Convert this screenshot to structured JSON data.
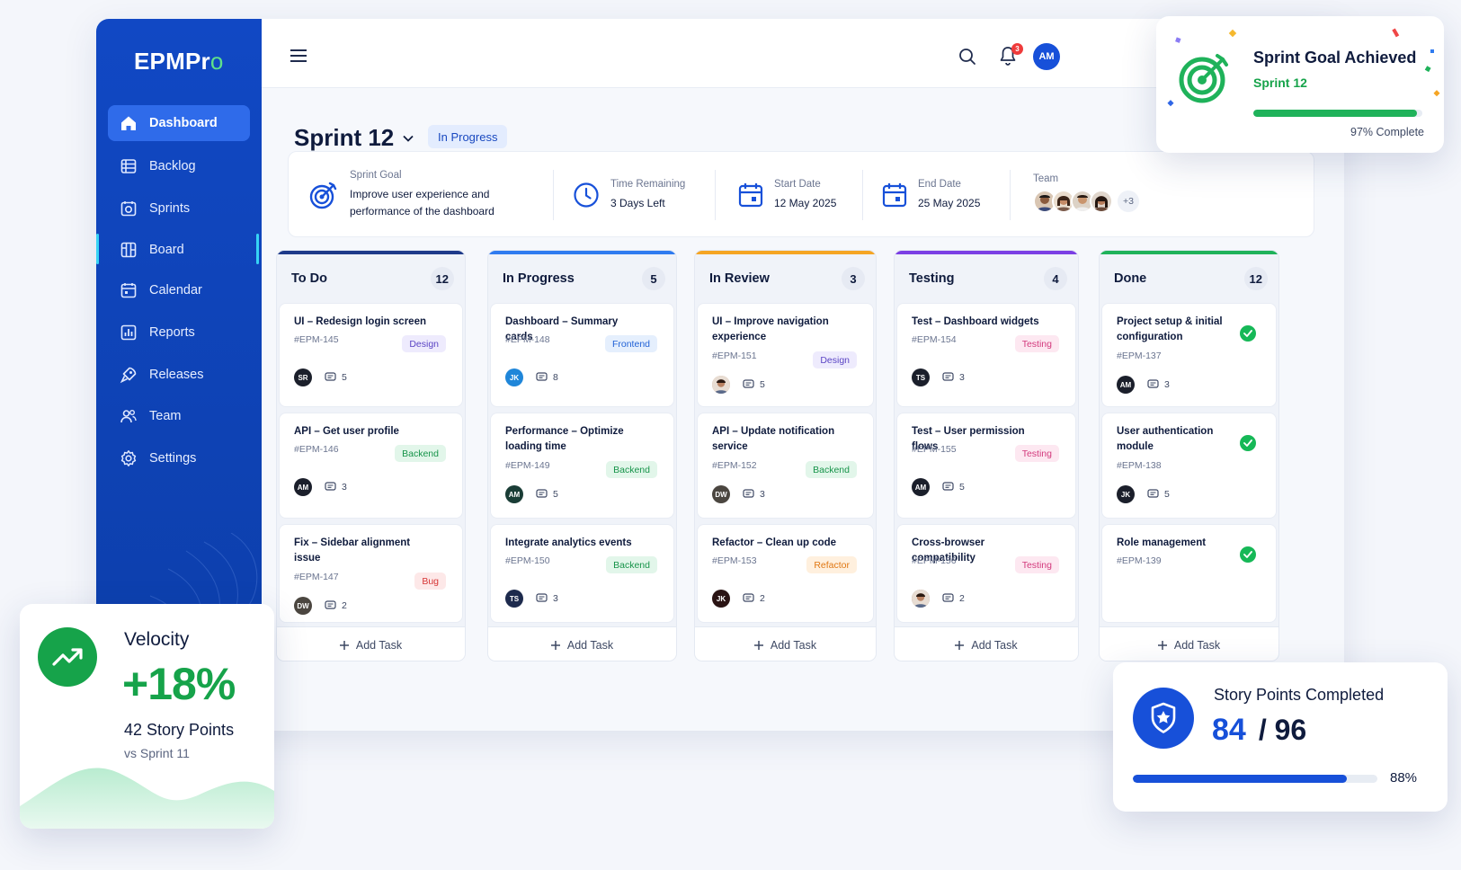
{
  "app": {
    "logo_main": "EPMPr",
    "logo_accent": "o"
  },
  "sidebar": {
    "items": [
      {
        "label": "Dashboard",
        "icon": "home-icon",
        "active": true
      },
      {
        "label": "Backlog",
        "icon": "list-icon"
      },
      {
        "label": "Sprints",
        "icon": "sprint-icon"
      },
      {
        "label": "Board",
        "icon": "board-icon",
        "marked": true
      },
      {
        "label": "Calendar",
        "icon": "calendar-icon"
      },
      {
        "label": "Reports",
        "icon": "reports-icon"
      },
      {
        "label": "Releases",
        "icon": "releases-icon"
      },
      {
        "label": "Team",
        "icon": "team-icon"
      },
      {
        "label": "Settings",
        "icon": "settings-icon"
      }
    ]
  },
  "topbar": {
    "notification_count": "3",
    "user_initials": "AM"
  },
  "sprint": {
    "title": "Sprint 12",
    "status": "In Progress"
  },
  "info": {
    "goal_label": "Sprint Goal",
    "goal_line1": "Improve user experience and",
    "goal_line2": "performance of the dashboard",
    "time_label": "Time Remaining",
    "time_value": "3 Days Left",
    "start_label": "Start Date",
    "start_value": "12 May 2025",
    "end_label": "End Date",
    "end_value": "25 May 2025",
    "team_label": "Team",
    "team_more": "+3"
  },
  "board": {
    "add_task_label": "Add Task",
    "columns": [
      {
        "title": "To Do",
        "count": "12",
        "color": "#1e3a8a",
        "cards": [
          {
            "title": "UI – Redesign login screen",
            "id": "#EPM-145",
            "tag": "Design",
            "tag_type": "design",
            "assignee": "SR",
            "avatar_color": "#1b1f2b",
            "comments": "5"
          },
          {
            "title": "API – Get user profile",
            "id": "#EPM-146",
            "tag": "Backend",
            "tag_type": "backend",
            "assignee": "AM",
            "avatar_color": "#1b1f2b",
            "comments": "3"
          },
          {
            "title": "Fix – Sidebar alignment issue",
            "id": "#EPM-147",
            "tag": "Bug",
            "tag_type": "bug",
            "assignee": "DW",
            "avatar_color": "#4b4640",
            "comments": "2"
          }
        ]
      },
      {
        "title": "In Progress",
        "count": "5",
        "color": "#2f7bf0",
        "cards": [
          {
            "title": "Dashboard – Summary cards",
            "id": "#EPM-148",
            "tag": "Frontend",
            "tag_type": "frontend",
            "assignee": "JK",
            "avatar_color": "#1f86d9",
            "comments": "8"
          },
          {
            "title": "Performance – Optimize loading time",
            "id": "#EPM-149",
            "tag": "Backend",
            "tag_type": "backend",
            "assignee": "AM",
            "avatar_color": "#1a3d36",
            "comments": "5"
          },
          {
            "title": "Integrate analytics events",
            "id": "#EPM-150",
            "tag": "Backend",
            "tag_type": "backend",
            "assignee": "TS",
            "avatar_color": "#1d2a4d",
            "comments": "3"
          }
        ]
      },
      {
        "title": "In Review",
        "count": "3",
        "color": "#f5a524",
        "cards": [
          {
            "title": "UI – Improve navigation experience",
            "id": "#EPM-151",
            "tag": "Design",
            "tag_type": "design",
            "assignee": "",
            "avatar_color": "#c89a7e",
            "comments": "5"
          },
          {
            "title": "API – Update notification service",
            "id": "#EPM-152",
            "tag": "Backend",
            "tag_type": "backend",
            "assignee": "DW",
            "avatar_color": "#4b4640",
            "comments": "3"
          },
          {
            "title": "Refactor – Clean up code",
            "id": "#EPM-153",
            "tag": "Refactor",
            "tag_type": "refactor",
            "assignee": "JK",
            "avatar_color": "#2a1414",
            "comments": "2"
          }
        ]
      },
      {
        "title": "Testing",
        "count": "4",
        "color": "#7b3fe4",
        "cards": [
          {
            "title": "Test – Dashboard widgets",
            "id": "#EPM-154",
            "tag": "Testing",
            "tag_type": "testing",
            "assignee": "TS",
            "avatar_color": "#1b1f2b",
            "comments": "3"
          },
          {
            "title": "Test – User permission flows",
            "id": "#EPM-155",
            "tag": "Testing",
            "tag_type": "testing",
            "assignee": "AM",
            "avatar_color": "#1b1f2b",
            "comments": "5"
          },
          {
            "title": "Cross-browser compatibility",
            "id": "#EPM-156",
            "tag": "Testing",
            "tag_type": "testing",
            "assignee": "",
            "avatar_color": "#8a6b57",
            "comments": "2"
          }
        ]
      },
      {
        "title": "Done",
        "count": "12",
        "color": "#1fb25a",
        "cards": [
          {
            "title": "Project setup & initial configuration",
            "id": "#EPM-137",
            "tag": "",
            "tag_type": "done",
            "assignee": "AM",
            "avatar_color": "#1b1f2b",
            "comments": "3"
          },
          {
            "title": "User authentication module",
            "id": "#EPM-138",
            "tag": "",
            "tag_type": "done",
            "assignee": "JK",
            "avatar_color": "#1b1f2b",
            "comments": "5"
          },
          {
            "title": "Role management",
            "id": "#EPM-139",
            "tag": "",
            "tag_type": "done",
            "assignee": "",
            "avatar_color": "",
            "comments": ""
          }
        ]
      }
    ]
  },
  "goal_card": {
    "title": "Sprint Goal Achieved",
    "subtitle": "Sprint 12",
    "progress_text": "97% Complete",
    "progress": 0.97
  },
  "velocity_card": {
    "title": "Velocity",
    "value": "+18%",
    "points": "42 Story Points",
    "compare": "vs Sprint 11"
  },
  "story_card": {
    "title": "Story Points Completed",
    "done": "84",
    "total": "/ 96",
    "percent": "88%",
    "progress": 0.875
  }
}
